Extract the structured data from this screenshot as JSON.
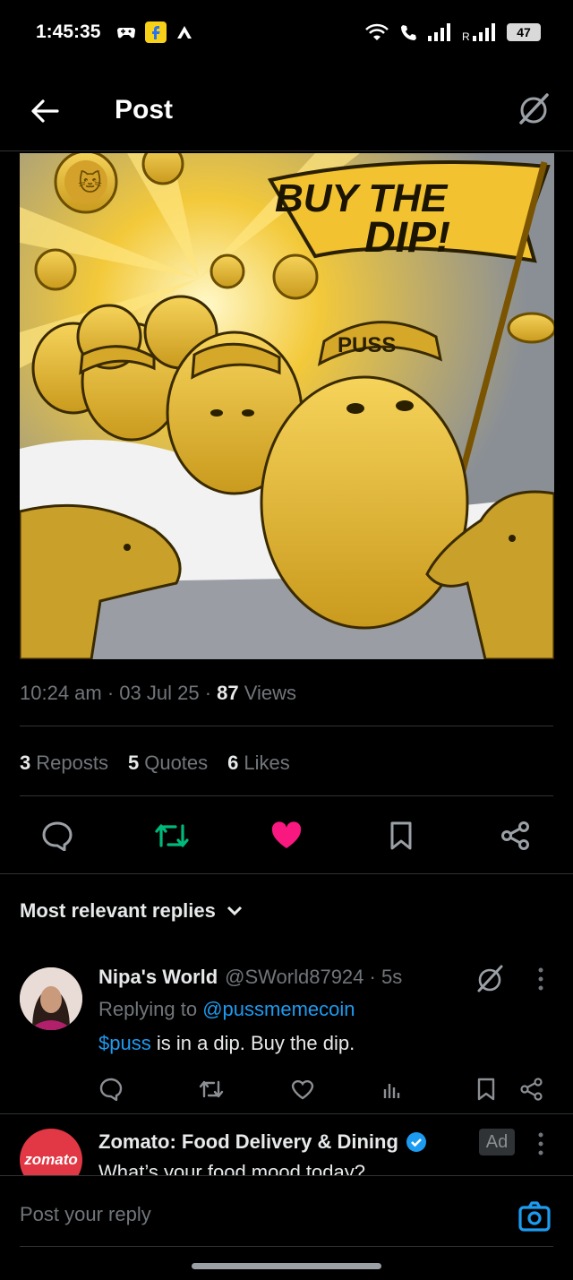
{
  "status_bar": {
    "time": "1:45:35",
    "battery": "47"
  },
  "header": {
    "title": "Post"
  },
  "post": {
    "image_alt": "",
    "banner_line1": "BUY THE",
    "banner_line2": "DIP!",
    "helmet_text": "PUSS",
    "time": "10:24 am",
    "date": "03 Jul 25",
    "views_count": "87",
    "views_label": "Views",
    "reposts_count": "3",
    "reposts_label": "Reposts",
    "quotes_count": "5",
    "quotes_label": "Quotes",
    "likes_count": "6",
    "likes_label": "Likes"
  },
  "replies_sort": {
    "label": "Most relevant replies"
  },
  "reply": {
    "name": "Nipa's World",
    "handle": "@SWorld87924",
    "age": "5s",
    "replying_prefix": "Replying to",
    "replying_mention": "@pussmemecoin",
    "cashtag": "$puss",
    "text_rest": " is in a dip. Buy the dip."
  },
  "ad": {
    "name": "Zomato: Food Delivery & Dining",
    "text": "What’s your food mood today?",
    "badge": "Ad",
    "avatar_text": "zomato"
  },
  "composer": {
    "placeholder": "Post your reply"
  },
  "colors": {
    "accent_blue": "#1d9bf0",
    "repost_green": "#00ba7c",
    "like_pink": "#f91880",
    "muted": "#71767b"
  }
}
